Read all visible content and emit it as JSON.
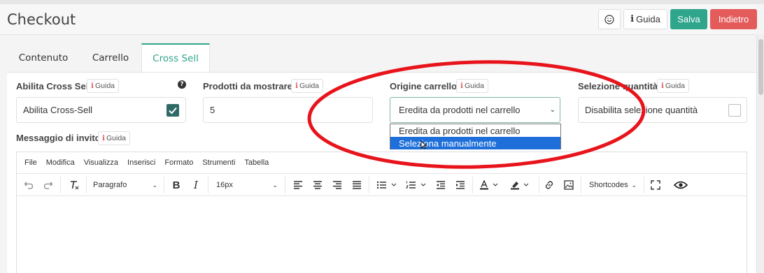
{
  "header": {
    "title": "Checkout",
    "emoji_icon": "smiley-icon",
    "guide_label": "Guida",
    "save_label": "Salva",
    "back_label": "Indietro"
  },
  "tabs": [
    {
      "label": "Contenuto",
      "active": false
    },
    {
      "label": "Carrello",
      "active": false
    },
    {
      "label": "Cross Sell",
      "active": true
    }
  ],
  "fields": {
    "enable_cross_sell": {
      "label": "Abilita Cross Sell",
      "guide": "Guida",
      "value": "Abilita Cross-Sell",
      "checked": true
    },
    "products_to_show": {
      "label": "Prodotti da mostrare",
      "guide": "Guida",
      "value": "5"
    },
    "cart_origin": {
      "label": "Origine carrello",
      "guide": "Guida",
      "selected": "Eredita da prodotti nel carrello",
      "options": [
        "Eredita da prodotti nel carrello",
        "Seleziona manualmente"
      ],
      "highlighted_index": 1
    },
    "quantity_selection": {
      "label": "Selezione quantità",
      "guide": "Guida",
      "value": "Disabilita selezione quantità",
      "checked": false
    },
    "invite_message": {
      "label": "Messaggio di invito",
      "guide": "Guida"
    }
  },
  "editor": {
    "menu": [
      "File",
      "Modifica",
      "Visualizza",
      "Inserisci",
      "Formato",
      "Strumenti",
      "Tabella"
    ],
    "block_format": "Paragrafo",
    "font_size": "16px",
    "shortcodes_label": "Shortcodes"
  },
  "colors": {
    "accent": "#2fa58c",
    "danger": "#e45b5b",
    "checkbox": "#2e6b67",
    "selection": "#1e6fd9",
    "annotation": "#e8141c"
  }
}
